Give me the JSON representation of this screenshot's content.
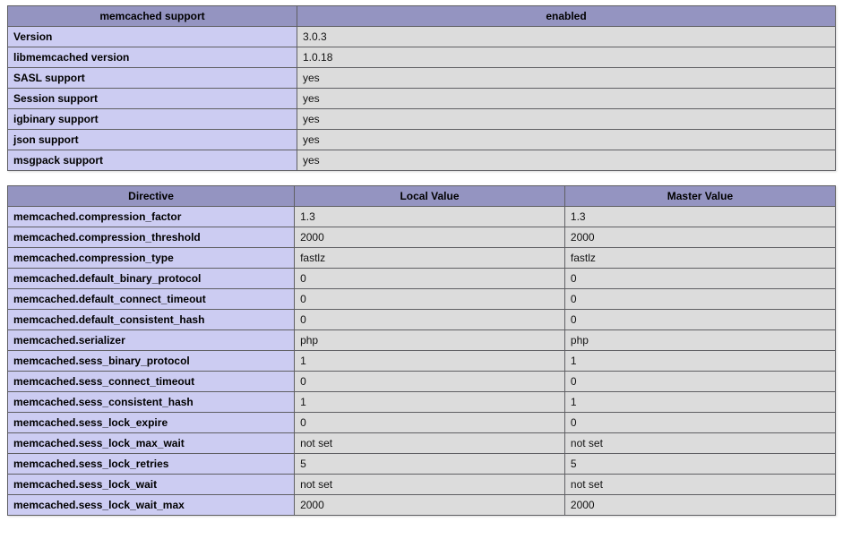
{
  "support": {
    "header_key": "memcached support",
    "header_value": "enabled",
    "rows": [
      {
        "k": "Version",
        "v": "3.0.3"
      },
      {
        "k": "libmemcached version",
        "v": "1.0.18"
      },
      {
        "k": "SASL support",
        "v": "yes"
      },
      {
        "k": "Session support",
        "v": "yes"
      },
      {
        "k": "igbinary support",
        "v": "yes"
      },
      {
        "k": "json support",
        "v": "yes"
      },
      {
        "k": "msgpack support",
        "v": "yes"
      }
    ]
  },
  "directives": {
    "header_directive": "Directive",
    "header_local": "Local Value",
    "header_master": "Master Value",
    "rows": [
      {
        "d": "memcached.compression_factor",
        "l": "1.3",
        "m": "1.3"
      },
      {
        "d": "memcached.compression_threshold",
        "l": "2000",
        "m": "2000"
      },
      {
        "d": "memcached.compression_type",
        "l": "fastlz",
        "m": "fastlz"
      },
      {
        "d": "memcached.default_binary_protocol",
        "l": "0",
        "m": "0"
      },
      {
        "d": "memcached.default_connect_timeout",
        "l": "0",
        "m": "0"
      },
      {
        "d": "memcached.default_consistent_hash",
        "l": "0",
        "m": "0"
      },
      {
        "d": "memcached.serializer",
        "l": "php",
        "m": "php"
      },
      {
        "d": "memcached.sess_binary_protocol",
        "l": "1",
        "m": "1"
      },
      {
        "d": "memcached.sess_connect_timeout",
        "l": "0",
        "m": "0"
      },
      {
        "d": "memcached.sess_consistent_hash",
        "l": "1",
        "m": "1"
      },
      {
        "d": "memcached.sess_lock_expire",
        "l": "0",
        "m": "0"
      },
      {
        "d": "memcached.sess_lock_max_wait",
        "l": "not set",
        "m": "not set"
      },
      {
        "d": "memcached.sess_lock_retries",
        "l": "5",
        "m": "5"
      },
      {
        "d": "memcached.sess_lock_wait",
        "l": "not set",
        "m": "not set"
      },
      {
        "d": "memcached.sess_lock_wait_max",
        "l": "2000",
        "m": "2000"
      }
    ]
  }
}
